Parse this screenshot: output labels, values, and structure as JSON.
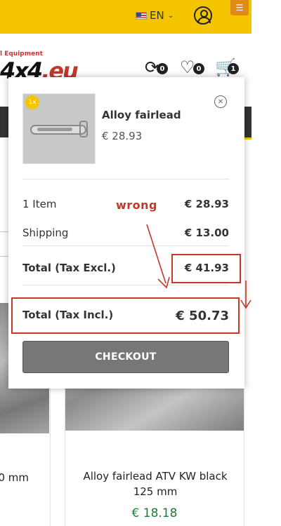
{
  "topbar": {
    "language": "EN",
    "menu_label": "☰"
  },
  "logo": {
    "tagline": "l Equipment",
    "brand_prefix": "4x4",
    "brand_suffix": ".eu"
  },
  "header_icons": {
    "compare_count": "0",
    "wishlist_count": "0",
    "cart_count": "1"
  },
  "cart_dropdown": {
    "item": {
      "quantity": "1x",
      "name": "Alloy fairlead",
      "price": "€ 28.93"
    },
    "summary": {
      "items_label": "1 Item",
      "items_value": "€ 28.93",
      "shipping_label": "Shipping",
      "shipping_value": "€ 13.00",
      "total_excl_label": "Total (Tax Excl.)",
      "total_excl_value": "€ 41.93",
      "total_incl_label": "Total (Tax Incl.)",
      "total_incl_value": "€ 50.73"
    },
    "checkout_label": "CHECKOUT"
  },
  "annotation": {
    "text": "wrong",
    "color": "#c0392b"
  },
  "products": {
    "left_name": "0 mm",
    "right_name": "Alloy fairlead ATV KW black 125 mm",
    "right_price": "€ 18.18"
  },
  "colors": {
    "brand_yellow": "#f5c400",
    "price_green": "#1c7c3a",
    "checkout_gray": "#777777"
  }
}
